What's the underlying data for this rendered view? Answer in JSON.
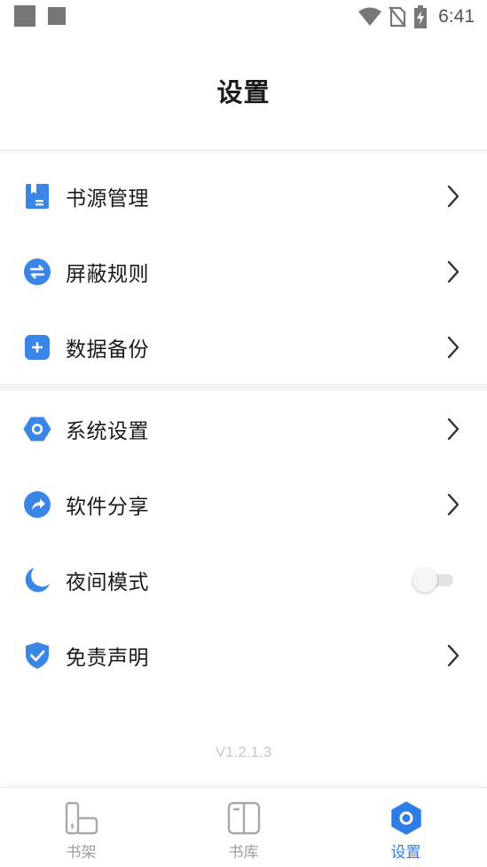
{
  "status_bar": {
    "time": "6:41"
  },
  "header": {
    "title": "设置"
  },
  "menu_group_1": [
    {
      "label": "书源管理",
      "icon": "book-source-icon"
    },
    {
      "label": "屏蔽规则",
      "icon": "swap-arrows-icon"
    },
    {
      "label": "数据备份",
      "icon": "add-square-icon"
    }
  ],
  "menu_group_2": [
    {
      "label": "系统设置",
      "icon": "hexagon-settings-icon"
    },
    {
      "label": "软件分享",
      "icon": "share-arrow-icon"
    },
    {
      "label": "夜间模式",
      "icon": "moon-icon",
      "toggle": false
    },
    {
      "label": "免责声明",
      "icon": "shield-check-icon"
    }
  ],
  "version": "V1.2.1.3",
  "tabbar": {
    "tabs": [
      {
        "label": "书架",
        "active": false
      },
      {
        "label": "书库",
        "active": false
      },
      {
        "label": "设置",
        "active": true
      }
    ]
  },
  "colors": {
    "accent": "#2f7ee6",
    "icon_blue": "#3a86e8",
    "inactive": "#9e9e9e"
  }
}
